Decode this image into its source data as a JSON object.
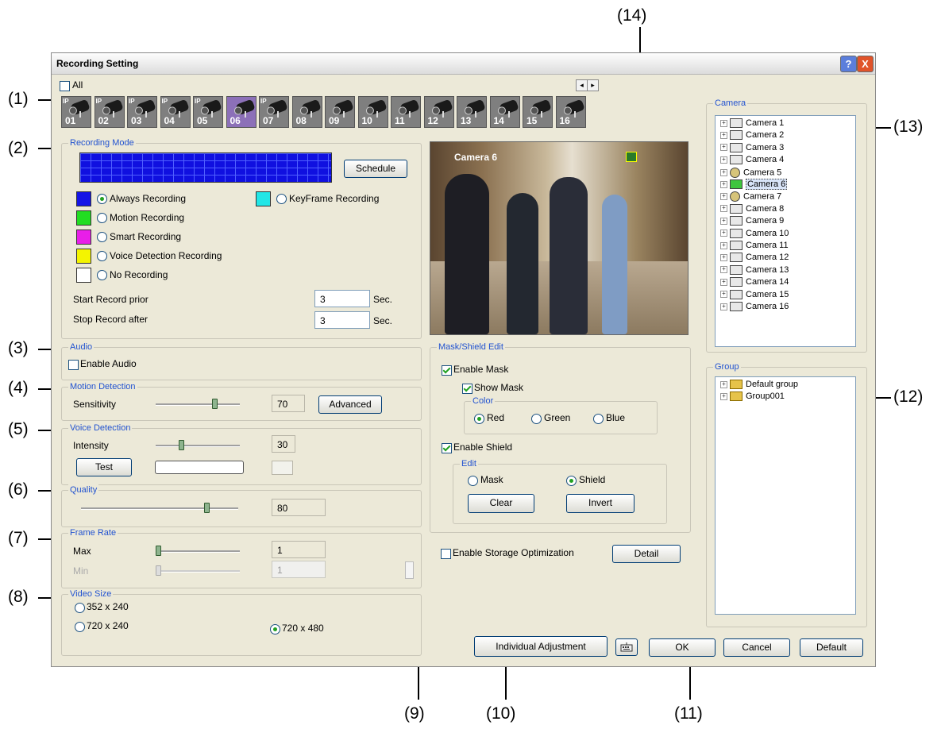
{
  "callouts": [
    "(1)",
    "(2)",
    "(3)",
    "(4)",
    "(5)",
    "(6)",
    "(7)",
    "(8)",
    "(9)",
    "(10)",
    "(11)",
    "(12)",
    "(13)",
    "(14)"
  ],
  "window": {
    "title": "Recording Setting",
    "help_label": "?",
    "close_label": "X"
  },
  "camera_strip": {
    "all_label": "All",
    "scroll_left": "◂",
    "scroll_right": "▸",
    "cameras": [
      {
        "num": "01",
        "ip": "IP"
      },
      {
        "num": "02",
        "ip": "IP"
      },
      {
        "num": "03",
        "ip": "IP"
      },
      {
        "num": "04",
        "ip": "IP"
      },
      {
        "num": "05",
        "ip": "IP"
      },
      {
        "num": "06",
        "ip": ""
      },
      {
        "num": "07",
        "ip": "IP"
      },
      {
        "num": "08",
        "ip": ""
      },
      {
        "num": "09",
        "ip": ""
      },
      {
        "num": "10",
        "ip": ""
      },
      {
        "num": "11",
        "ip": ""
      },
      {
        "num": "12",
        "ip": ""
      },
      {
        "num": "13",
        "ip": ""
      },
      {
        "num": "14",
        "ip": ""
      },
      {
        "num": "15",
        "ip": ""
      },
      {
        "num": "16",
        "ip": ""
      }
    ],
    "selected": "06"
  },
  "recording_mode": {
    "legend": "Recording Mode",
    "schedule_button": "Schedule",
    "schedule_color": "#1010e0",
    "options": [
      {
        "label": "Always Recording",
        "color": "#1414e6",
        "selected": true
      },
      {
        "label": "Motion Recording",
        "color": "#22dd22",
        "selected": false
      },
      {
        "label": "Smart Recording",
        "color": "#e81ee8",
        "selected": false
      },
      {
        "label": "Voice Detection Recording",
        "color": "#f4f400",
        "selected": false
      },
      {
        "label": "No Recording",
        "color": "#ffffff",
        "selected": false
      },
      {
        "label": "KeyFrame Recording",
        "color": "#22e6e6",
        "selected": false
      }
    ],
    "start_label": "Start Record prior",
    "start_value": "3",
    "start_unit": "Sec.",
    "stop_label": "Stop Record after",
    "stop_value": "3",
    "stop_unit": "Sec."
  },
  "audio": {
    "legend": "Audio",
    "enable_label": "Enable Audio",
    "enabled": false
  },
  "motion_detection": {
    "legend": "Motion Detection",
    "sensitivity_label": "Sensitivity",
    "value": "70",
    "level": 0.7,
    "advanced_button": "Advanced"
  },
  "voice_detection": {
    "legend": "Voice Detection",
    "intensity_label": "Intensity",
    "value": "30",
    "level": 0.3,
    "test_button": "Test"
  },
  "quality": {
    "legend": "Quality",
    "value": "80",
    "level": 0.8
  },
  "frame_rate": {
    "legend": "Frame Rate",
    "max_label": "Max",
    "max_value": "1",
    "min_label": "Min",
    "min_value": "1"
  },
  "video_size": {
    "legend": "Video Size",
    "options": [
      {
        "label": "352 x 240",
        "selected": false
      },
      {
        "label": "720 x 240",
        "selected": false
      },
      {
        "label": "720 x 480",
        "selected": true
      }
    ]
  },
  "preview": {
    "camera_label": "Camera 6"
  },
  "mask_shield": {
    "legend": "Mask/Shield Edit",
    "enable_mask_label": "Enable Mask",
    "show_mask_label": "Show Mask",
    "color_legend": "Color",
    "colors": [
      {
        "label": "Red",
        "selected": true
      },
      {
        "label": "Green",
        "selected": false
      },
      {
        "label": "Blue",
        "selected": false
      }
    ],
    "enable_shield_label": "Enable Shield",
    "edit_legend": "Edit",
    "edit_options": [
      {
        "label": "Mask",
        "selected": false
      },
      {
        "label": "Shield",
        "selected": true
      }
    ],
    "clear_button": "Clear",
    "invert_button": "Invert"
  },
  "storage": {
    "enable_label": "Enable Storage Optimization",
    "detail_button": "Detail"
  },
  "camera_tree": {
    "legend": "Camera",
    "items": [
      {
        "label": "Camera 1",
        "ip": false
      },
      {
        "label": "Camera 2",
        "ip": false
      },
      {
        "label": "Camera 3",
        "ip": false
      },
      {
        "label": "Camera 4",
        "ip": false
      },
      {
        "label": "Camera 5",
        "ip": true
      },
      {
        "label": "Camera 6",
        "ip": false,
        "selected": true
      },
      {
        "label": "Camera 7",
        "ip": true
      },
      {
        "label": "Camera 8",
        "ip": false
      },
      {
        "label": "Camera 9",
        "ip": false
      },
      {
        "label": "Camera 10",
        "ip": false
      },
      {
        "label": "Camera 11",
        "ip": false
      },
      {
        "label": "Camera 12",
        "ip": false
      },
      {
        "label": "Camera 13",
        "ip": false
      },
      {
        "label": "Camera 14",
        "ip": false
      },
      {
        "label": "Camera 15",
        "ip": false
      },
      {
        "label": "Camera 16",
        "ip": false
      }
    ]
  },
  "group_tree": {
    "legend": "Group",
    "items": [
      {
        "label": "Default group"
      },
      {
        "label": "Group001"
      }
    ]
  },
  "footer": {
    "individual_button": "Individual Adjustment",
    "ok_button": "OK",
    "cancel_button": "Cancel",
    "default_button": "Default"
  }
}
